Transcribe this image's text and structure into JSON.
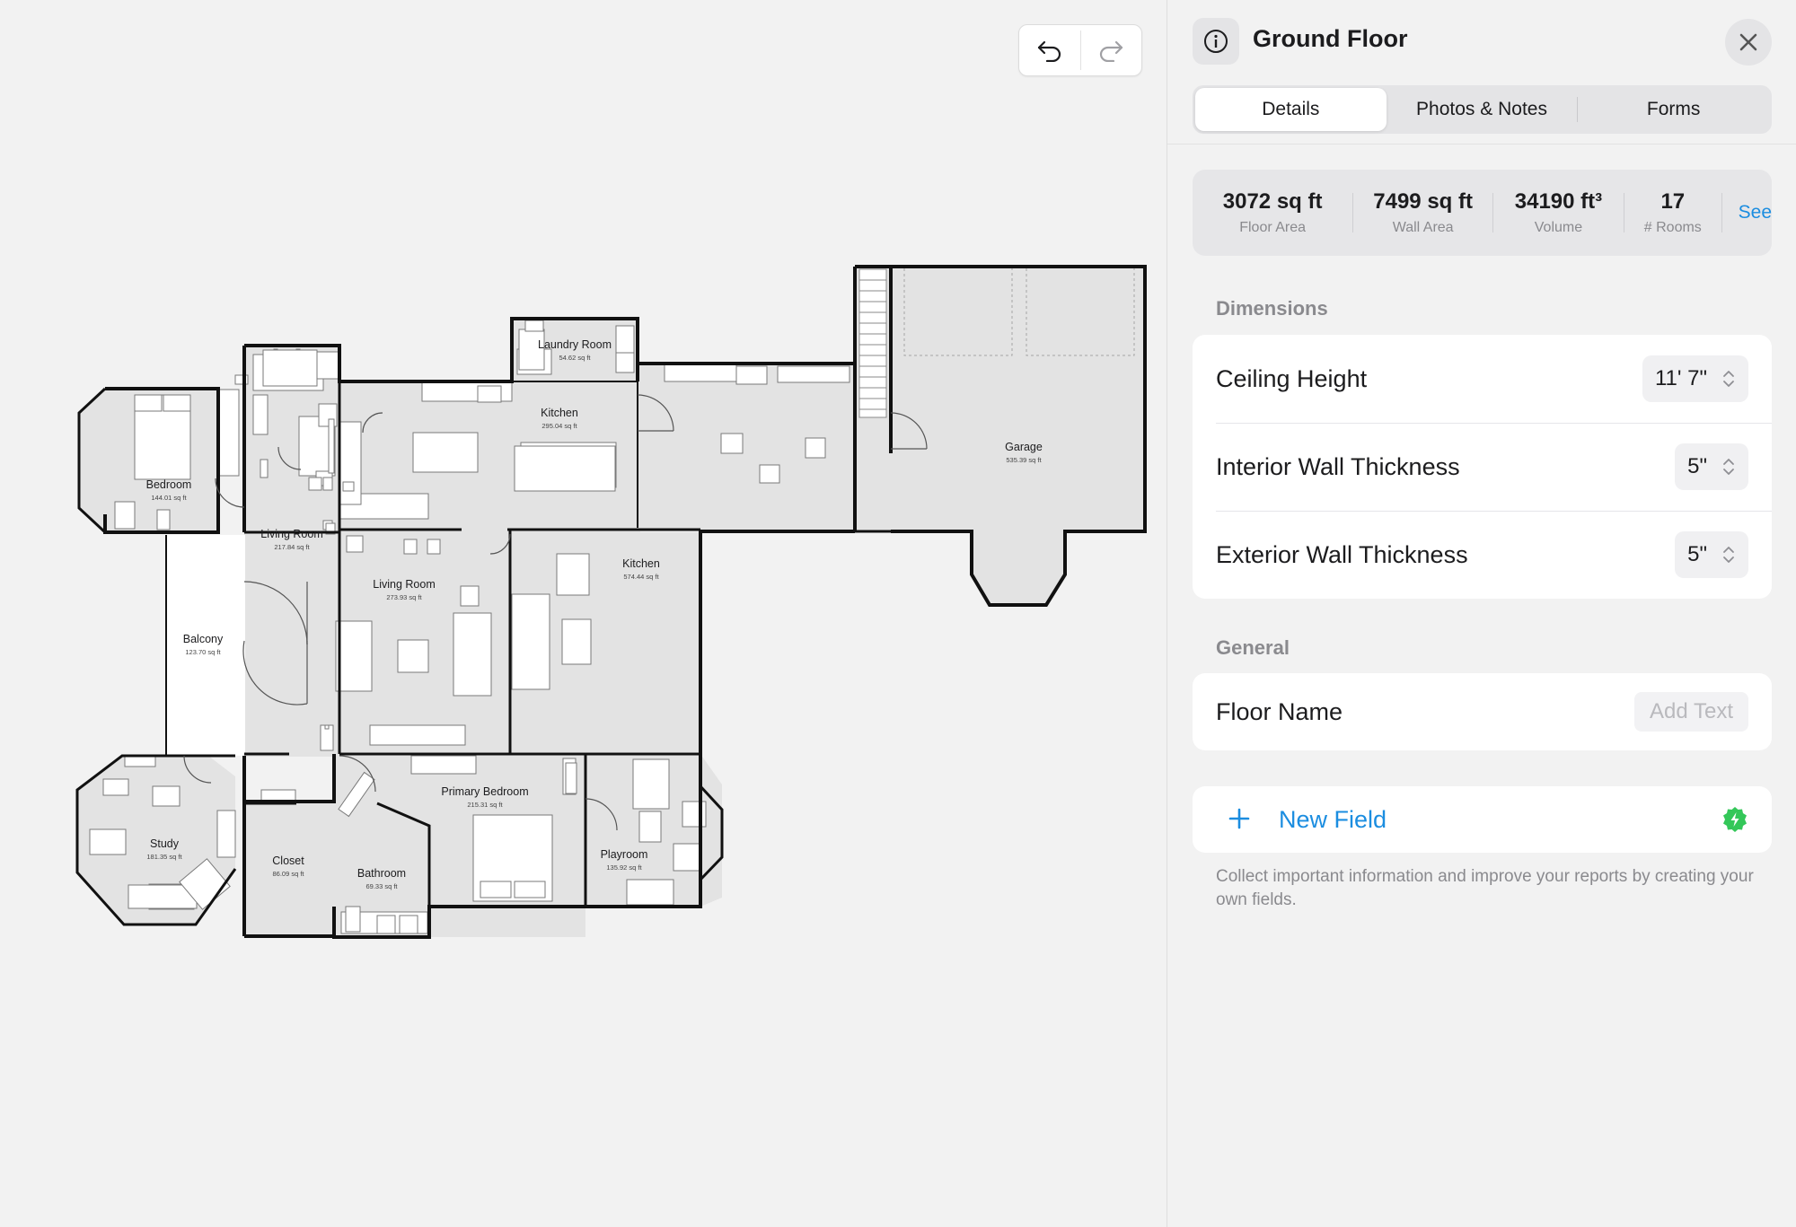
{
  "canvas": {
    "undo_icon": "undo-arrow-icon",
    "redo_icon": "redo-arrow-icon",
    "rooms": [
      {
        "name": "Laundry Room",
        "area": "54.62 sq ft"
      },
      {
        "name": "Kitchen",
        "area": "295.04 sq ft"
      },
      {
        "name": "Bedroom",
        "area": "144.01 sq ft"
      },
      {
        "name": "Living Room",
        "area": "217.84 sq ft"
      },
      {
        "name": "Living Room",
        "area": "273.93 sq ft"
      },
      {
        "name": "Kitchen",
        "area": "574.44 sq ft"
      },
      {
        "name": "Garage",
        "area": "535.39 sq ft"
      },
      {
        "name": "Balcony",
        "area": "123.70 sq ft"
      },
      {
        "name": "Primary Bedroom",
        "area": "215.31 sq ft"
      },
      {
        "name": "Study",
        "area": "181.35 sq ft"
      },
      {
        "name": "Closet",
        "area": "86.09 sq ft"
      },
      {
        "name": "Bathroom",
        "area": "69.33 sq ft"
      },
      {
        "name": "Playroom",
        "area": "135.92 sq ft"
      }
    ]
  },
  "panel": {
    "title": "Ground Floor",
    "info_icon": "info-circle-icon",
    "close_icon": "close-x-icon",
    "tabs": [
      {
        "label": "Details",
        "active": true
      },
      {
        "label": "Photos & Notes",
        "active": false
      },
      {
        "label": "Forms",
        "active": false
      }
    ],
    "stats": [
      {
        "value": "3072 sq ft",
        "label": "Floor Area"
      },
      {
        "value": "7499 sq ft",
        "label": "Wall Area"
      },
      {
        "value": "34190 ft³",
        "label": "Volume"
      },
      {
        "value": "17",
        "label": "# Rooms"
      }
    ],
    "see_link": "See",
    "dimensions": {
      "heading": "Dimensions",
      "rows": [
        {
          "label": "Ceiling Height",
          "value": "11' 7\""
        },
        {
          "label": "Interior Wall Thickness",
          "value": "5\""
        },
        {
          "label": "Exterior Wall Thickness",
          "value": "5\""
        }
      ]
    },
    "general": {
      "heading": "General",
      "floor_name_label": "Floor Name",
      "floor_name_placeholder": "Add Text"
    },
    "new_field_label": "New Field",
    "help_text": "Collect important information and improve your reports by creating your own fields.",
    "accent_color": "#1b8de0",
    "bolt_color": "#34c759"
  }
}
